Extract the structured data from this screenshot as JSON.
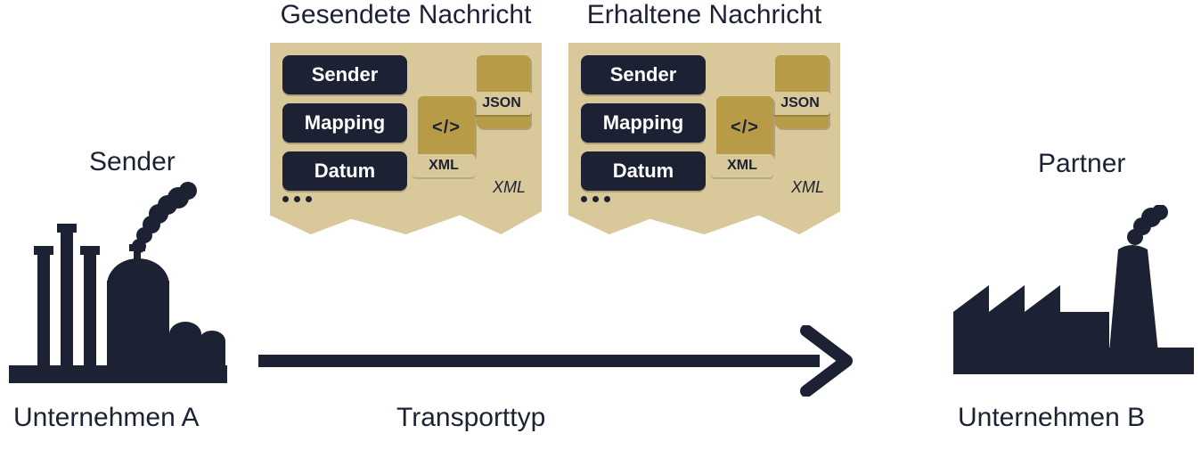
{
  "left": {
    "role_label": "Sender",
    "company_name": "Unternehmen A"
  },
  "right": {
    "role_label": "Partner",
    "company_name": "Unternehmen B"
  },
  "messages": {
    "sent": {
      "title": "Gesendete Nachricht"
    },
    "received": {
      "title": "Erhaltene Nachricht"
    },
    "card_fields": [
      "Sender",
      "Mapping",
      "Datum"
    ],
    "xml_code_glyph": "</>",
    "xml_band_label": "XML",
    "json_band_label": "JSON",
    "corner_type": "XML"
  },
  "transport": {
    "label": "Transporttyp"
  }
}
